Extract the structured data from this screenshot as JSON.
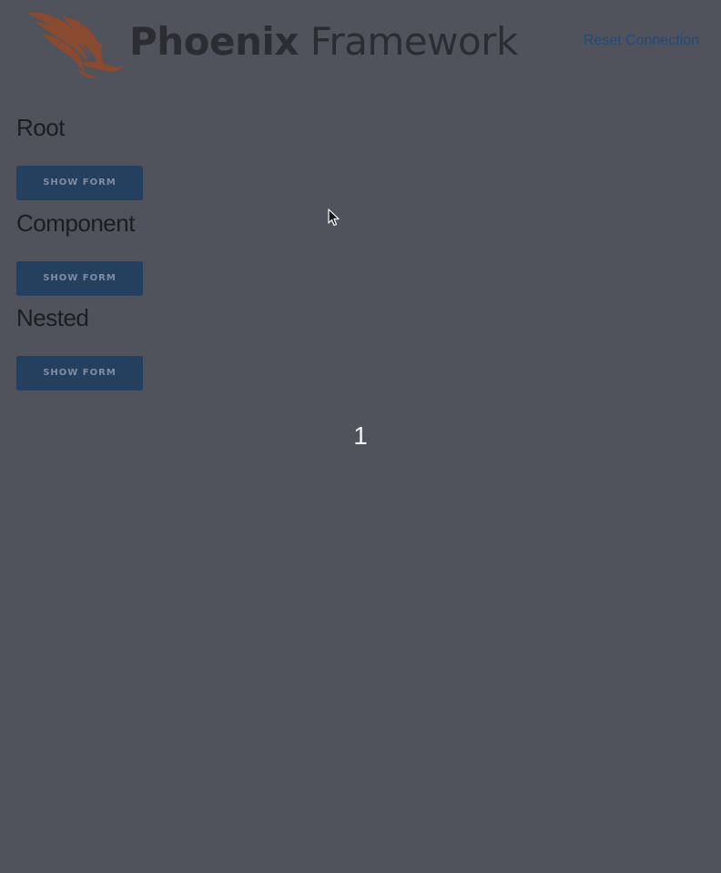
{
  "header": {
    "brand_bold": "Phoenix",
    "brand_light": "Framework",
    "reset_label": "Reset Connection"
  },
  "sections": [
    {
      "title": "Root",
      "button_label": "SHOW FORM"
    },
    {
      "title": "Component",
      "button_label": "SHOW FORM"
    },
    {
      "title": "Nested",
      "button_label": "SHOW FORM"
    }
  ],
  "counter": "1",
  "icons": {
    "logo": "phoenix-bird-icon",
    "cursor": "mouse-pointer-icon"
  },
  "colors": {
    "background": "#50535b",
    "logo": "#8a4a2f",
    "brand_text": "#2b2d33",
    "link": "#234a78",
    "button_bg": "#253f5e",
    "button_text": "#7f8ea2",
    "counter_text": "#f2f2f2"
  }
}
